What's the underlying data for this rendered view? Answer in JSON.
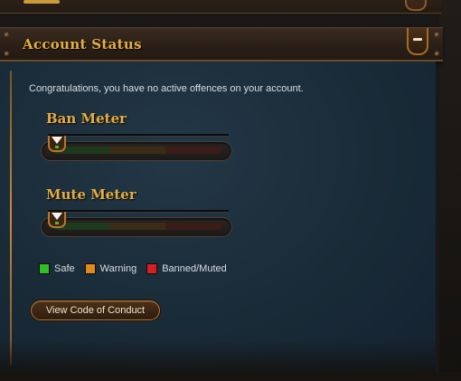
{
  "section": {
    "title": "Account Status"
  },
  "intro": {
    "text": "Congratulations, you have no active offences on your account."
  },
  "meters": {
    "ban": {
      "title": "Ban Meter",
      "level": 0
    },
    "mute": {
      "title": "Mute Meter",
      "level": 0
    }
  },
  "legend": {
    "items": [
      {
        "label": "Safe",
        "color": "#2fbf26"
      },
      {
        "label": "Warning",
        "color": "#e08a1e"
      },
      {
        "label": "Banned/Muted",
        "color": "#d42020"
      }
    ]
  },
  "actions": {
    "conduct_label": "View Code of Conduct"
  },
  "icons": {
    "collapse": "minus-icon",
    "marker": "triangle-down-icon"
  },
  "colors": {
    "accent_gold": "#e6ad3f",
    "panel_blue": "#1a2b38",
    "bronze_trim": "#b5782e"
  }
}
